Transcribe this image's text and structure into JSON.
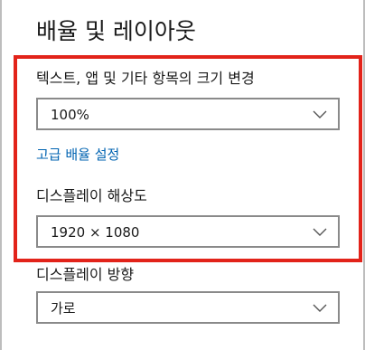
{
  "section": {
    "title": "배율 및 레이아웃"
  },
  "scale": {
    "label": "텍스트, 앱 및 기타 항목의 크기 변경",
    "value": "100%"
  },
  "advanced_link": {
    "label": "고급 배율 설정"
  },
  "resolution": {
    "label": "디스플레이 해상도",
    "value": "1920 × 1080"
  },
  "orientation": {
    "label": "디스플레이 방향",
    "value": "가로"
  },
  "colors": {
    "highlight_border": "#e2231a",
    "link": "#0063b1",
    "dropdown_border": "#8a8a8a"
  },
  "icons": {
    "dropdown": "chevron-down-icon"
  }
}
